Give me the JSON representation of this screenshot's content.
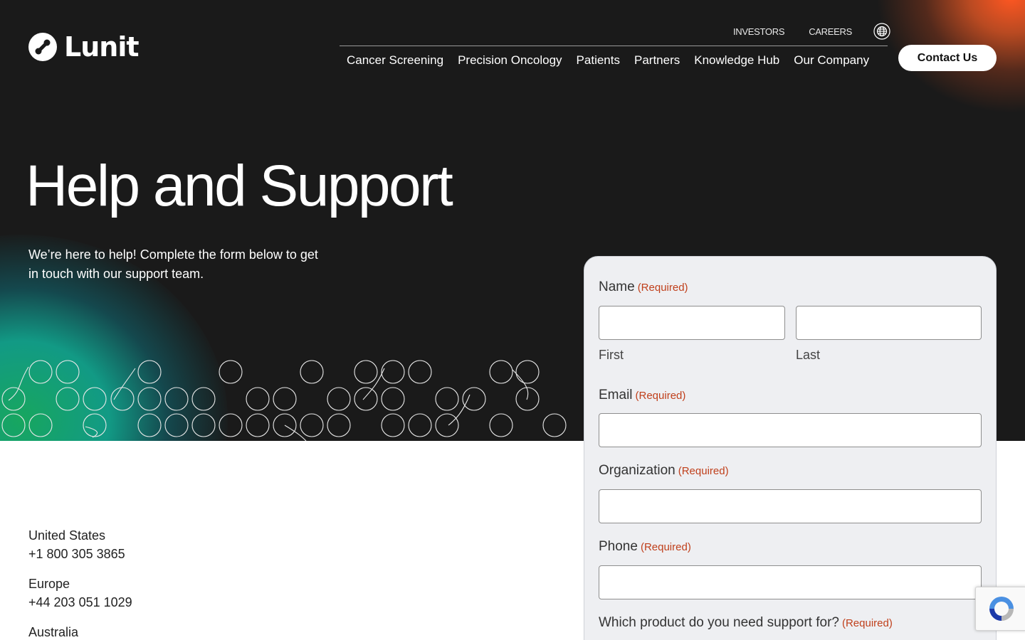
{
  "brand": {
    "logo_text": "Lunit"
  },
  "utility_nav": {
    "items": [
      "INVESTORS",
      "CAREERS"
    ],
    "language_icon": "globe-icon"
  },
  "main_nav": {
    "items": [
      "Cancer Screening",
      "Precision Oncology",
      "Patients",
      "Partners",
      "Knowledge Hub",
      "Our Company"
    ]
  },
  "header": {
    "contact_label": "Contact Us"
  },
  "hero": {
    "title": "Help and Support",
    "intro": "We’re here to help! Complete the form below to get in touch with our support team."
  },
  "contacts": [
    {
      "region": "United States",
      "phone": "+1 800 305 3865"
    },
    {
      "region": "Europe",
      "phone": "+44 203 051 1029"
    },
    {
      "region": "Australia",
      "phone": ""
    }
  ],
  "form": {
    "required_text": "(Required)",
    "name_label": "Name",
    "first_sublabel": "First",
    "last_sublabel": "Last",
    "email_label": "Email",
    "organization_label": "Organization",
    "phone_label": "Phone",
    "product_label": "Which product do you need support for?"
  },
  "colors": {
    "hero_bg": "#1a1a1a",
    "accent_orange": "#ff5722",
    "accent_teal": "#129a85",
    "required_red": "#c0401c",
    "form_bg": "#eeeff2"
  }
}
